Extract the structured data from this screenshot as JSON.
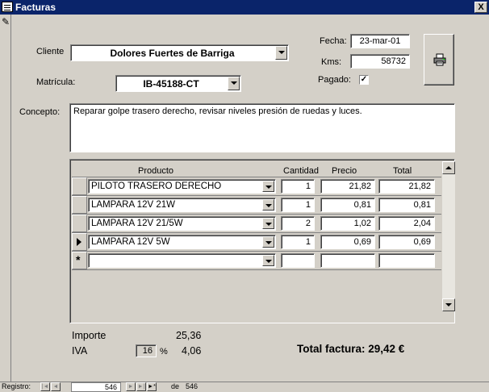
{
  "window": {
    "title": "Facturas",
    "close_label": "X"
  },
  "header": {
    "cliente_label": "Cliente",
    "cliente_value": "Dolores Fuertes de Barriga",
    "matricula_label": "Matrícula:",
    "matricula_value": "IB-45188-CT",
    "fecha_label": "Fecha:",
    "fecha_value": "23-mar-01",
    "kms_label": "Kms:",
    "kms_value": "58732",
    "pagado_label": "Pagado:",
    "pagado_checked": "✓"
  },
  "concepto": {
    "label": "Concepto:",
    "value": "Reparar golpe trasero derecho, revisar niveles presión de ruedas y luces."
  },
  "lines": {
    "headers": {
      "producto": "Producto",
      "cantidad": "Cantidad",
      "precio": "Precio",
      "total": "Total"
    },
    "rows": [
      {
        "producto": "PILOTO TRASERO DERECHO",
        "cantidad": "1",
        "precio": "21,82",
        "total": "21,82"
      },
      {
        "producto": "LAMPARA 12V 21W",
        "cantidad": "1",
        "precio": "0,81",
        "total": "0,81"
      },
      {
        "producto": "LAMPARA 12V 21/5W",
        "cantidad": "2",
        "precio": "1,02",
        "total": "2,04"
      },
      {
        "producto": "LAMPARA 12V 5W",
        "cantidad": "1",
        "precio": "0,69",
        "total": "0,69"
      }
    ],
    "new_row_marker": "*"
  },
  "summary": {
    "importe_label": "Importe",
    "importe_value": "25,36",
    "iva_label": "IVA",
    "iva_rate": "16",
    "iva_pct": "%",
    "iva_value": "4,06",
    "total_label": "Total factura: 29,42 €"
  },
  "navigation": {
    "registro_label": "Registro:",
    "current": "546",
    "of_label": "de",
    "total_records": "546",
    "first": "|◄",
    "prev": "◄",
    "next": "►",
    "last": "►|",
    "new": "►*"
  },
  "icons": {
    "form": "form-icon",
    "edit": "pencil-icon",
    "print": "printer-icon",
    "close": "close-icon",
    "current_row": "current-row-arrow-icon",
    "new_row": "new-record-star-icon"
  }
}
